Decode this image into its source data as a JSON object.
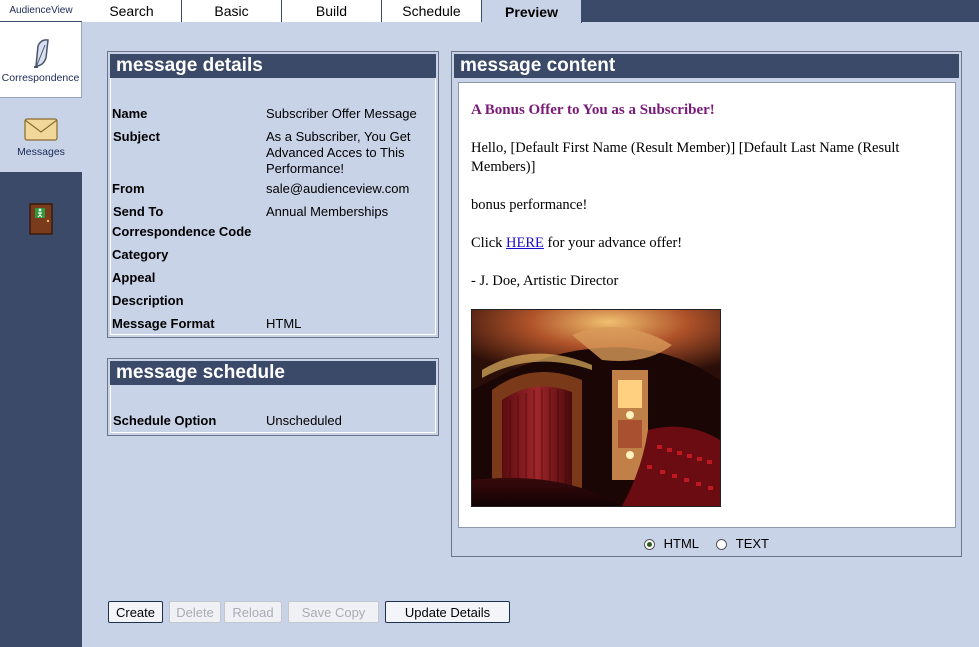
{
  "app": {
    "brand": "AudienceView"
  },
  "sidebar": {
    "items": [
      {
        "label": "Correspondence",
        "icon": "quill-pen-icon"
      },
      {
        "label": "Messages",
        "icon": "envelope-icon"
      },
      {
        "label": "",
        "icon": "exit-door-icon"
      }
    ]
  },
  "tabs": [
    {
      "label": "Search"
    },
    {
      "label": "Basic"
    },
    {
      "label": "Build"
    },
    {
      "label": "Schedule"
    },
    {
      "label": "Preview"
    }
  ],
  "details": {
    "title": "message details",
    "fields": [
      {
        "label": "Name",
        "value": "Subscriber Offer Message"
      },
      {
        "label": "Subject",
        "value": "As a Subscriber, You Get Advanced Acces to This Performance!"
      },
      {
        "label": "From",
        "value": "sale@audienceview.com"
      },
      {
        "label": "Send To",
        "value": "Annual Memberships"
      },
      {
        "label": "Correspondence Code",
        "value": ""
      },
      {
        "label": "Category",
        "value": ""
      },
      {
        "label": "Appeal",
        "value": ""
      },
      {
        "label": "Description",
        "value": ""
      },
      {
        "label": "Message Format",
        "value": "HTML"
      }
    ]
  },
  "schedule": {
    "title": "message schedule",
    "label": "Schedule Option",
    "value": "Unscheduled"
  },
  "content": {
    "title": "message content",
    "heading": "A Bonus Offer to You as a Subscriber!",
    "greeting": "Hello, [Default First Name (Result Member)] [Default Last Name (Result Members)]",
    "body": "bonus performance!",
    "click_prefix": "Click ",
    "link_text": "HERE",
    "click_suffix": " for your advance offer!",
    "signature": "- J. Doe, Artistic Director",
    "image": "theater-auditorium-photo",
    "format_options": [
      {
        "label": "HTML",
        "checked": true
      },
      {
        "label": "TEXT",
        "checked": false
      }
    ]
  },
  "buttons": [
    {
      "label": "Create",
      "enabled": true
    },
    {
      "label": "Delete",
      "enabled": false
    },
    {
      "label": "Reload",
      "enabled": false
    },
    {
      "label": "Save Copy",
      "enabled": false
    },
    {
      "label": "Update Details",
      "enabled": true
    }
  ],
  "colors": {
    "nav_dark": "#3c4a69",
    "background": "#c9d3e8",
    "heading_purple": "#7a1a78",
    "link_blue": "#1a0dcc"
  }
}
